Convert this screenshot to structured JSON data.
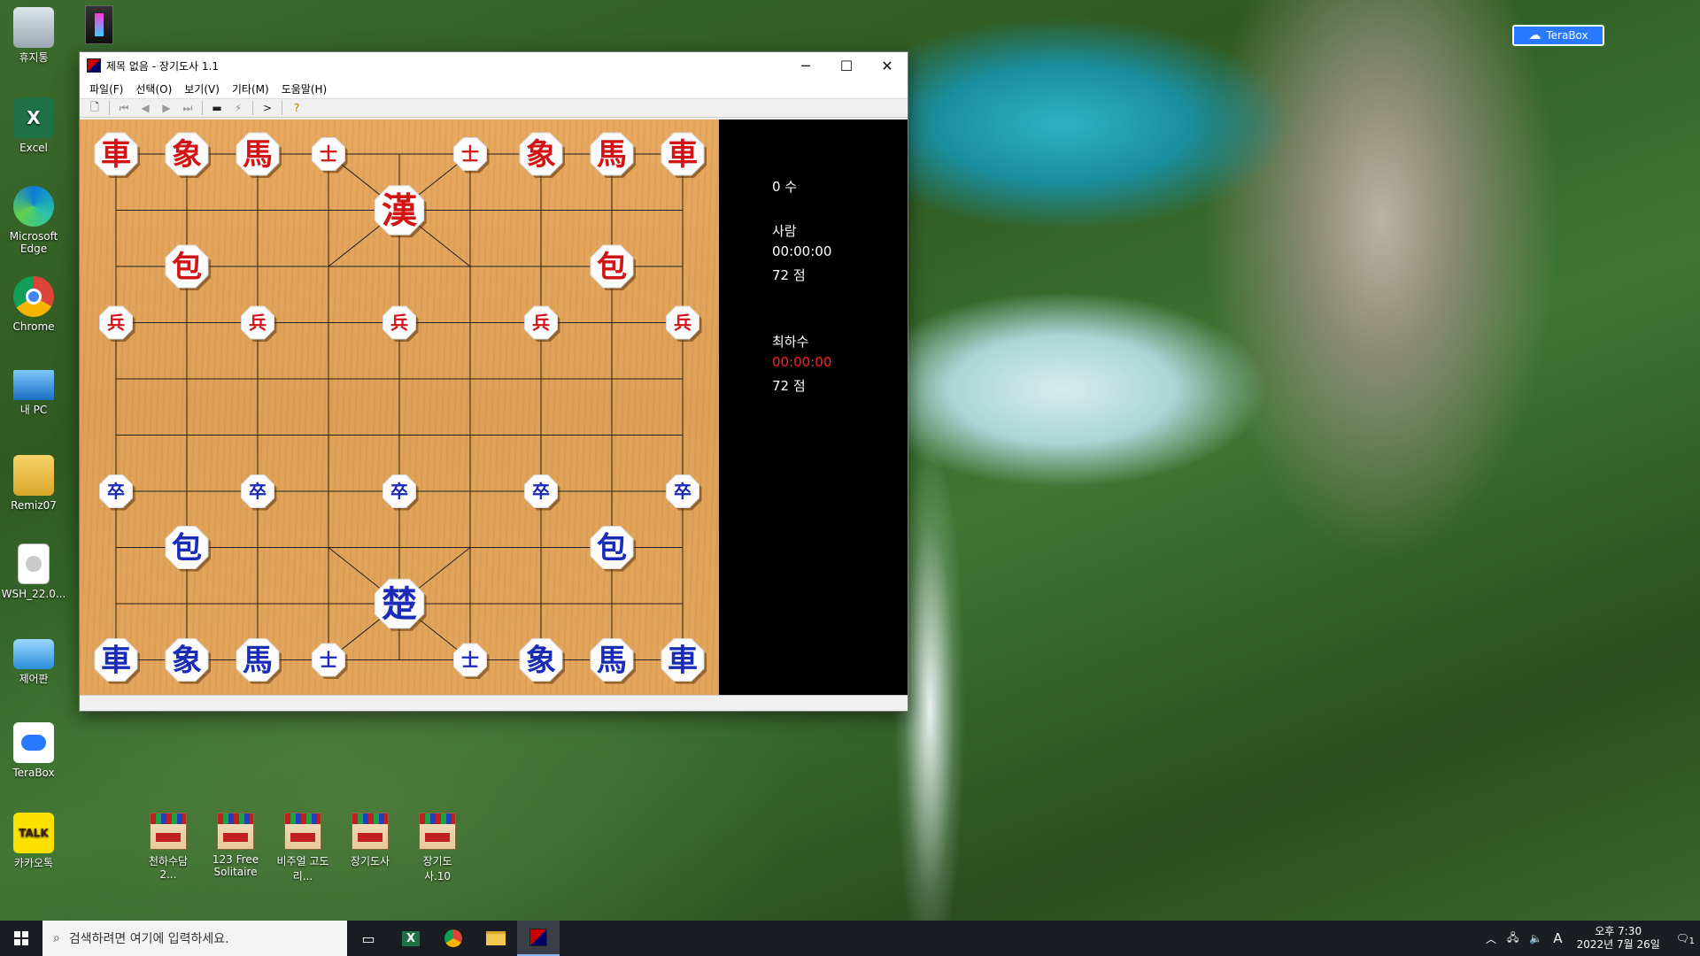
{
  "desktop": {
    "icons": [
      {
        "label": "휴지통"
      },
      {
        "label": "Excel"
      },
      {
        "label": "Microsoft Edge"
      },
      {
        "label": "Chrome"
      },
      {
        "label": "내 PC"
      },
      {
        "label": "Remiz07"
      },
      {
        "label": "WSH_22.0..."
      },
      {
        "label": "제어판"
      },
      {
        "label": "TeraBox"
      },
      {
        "label": "카카오톡"
      }
    ],
    "bottom_icons": [
      {
        "label": "천하수담2..."
      },
      {
        "label": "123 Free Solitaire"
      },
      {
        "label": "비주얼 고도리..."
      },
      {
        "label": "장기도사"
      },
      {
        "label": "장기도사.10"
      }
    ],
    "terabox_badge": "TeraBox"
  },
  "window": {
    "title": "제목 없음 - 장기도사 1.1",
    "menu": [
      "파일(F)",
      "선택(O)",
      "보기(V)",
      "기타(M)",
      "도움말(H)"
    ],
    "controls": {
      "minimize": "─",
      "maximize": "☐",
      "close": "✕"
    }
  },
  "board": {
    "red_pieces": [
      {
        "char": "車",
        "col": 0,
        "row": 0
      },
      {
        "char": "象",
        "col": 1,
        "row": 0
      },
      {
        "char": "馬",
        "col": 2,
        "row": 0
      },
      {
        "char": "士",
        "col": 3,
        "row": 0
      },
      {
        "char": "士",
        "col": 5,
        "row": 0
      },
      {
        "char": "象",
        "col": 6,
        "row": 0
      },
      {
        "char": "馬",
        "col": 7,
        "row": 0
      },
      {
        "char": "車",
        "col": 8,
        "row": 0
      },
      {
        "char": "漢",
        "col": 4,
        "row": 1
      },
      {
        "char": "包",
        "col": 1,
        "row": 2
      },
      {
        "char": "包",
        "col": 7,
        "row": 2
      },
      {
        "char": "兵",
        "col": 0,
        "row": 3
      },
      {
        "char": "兵",
        "col": 2,
        "row": 3
      },
      {
        "char": "兵",
        "col": 4,
        "row": 3
      },
      {
        "char": "兵",
        "col": 6,
        "row": 3
      },
      {
        "char": "兵",
        "col": 8,
        "row": 3
      }
    ],
    "blue_pieces": [
      {
        "char": "卒",
        "col": 0,
        "row": 6
      },
      {
        "char": "卒",
        "col": 2,
        "row": 6
      },
      {
        "char": "卒",
        "col": 4,
        "row": 6
      },
      {
        "char": "卒",
        "col": 6,
        "row": 6
      },
      {
        "char": "卒",
        "col": 8,
        "row": 6
      },
      {
        "char": "包",
        "col": 1,
        "row": 7
      },
      {
        "char": "包",
        "col": 7,
        "row": 7
      },
      {
        "char": "楚",
        "col": 4,
        "row": 8
      },
      {
        "char": "車",
        "col": 0,
        "row": 9
      },
      {
        "char": "象",
        "col": 1,
        "row": 9
      },
      {
        "char": "馬",
        "col": 2,
        "row": 9
      },
      {
        "char": "士",
        "col": 3,
        "row": 9
      },
      {
        "char": "士",
        "col": 5,
        "row": 9
      },
      {
        "char": "象",
        "col": 6,
        "row": 9
      },
      {
        "char": "馬",
        "col": 7,
        "row": 9
      },
      {
        "char": "車",
        "col": 8,
        "row": 9
      }
    ],
    "colors": {
      "red": "#d21414",
      "blue": "#1a2bb8"
    }
  },
  "panel": {
    "move_count": "0 수",
    "player1_name": "사람",
    "player1_time": "00:00:00",
    "player1_score": "72 점",
    "player2_name": "최하수",
    "player2_time": "00:00:00",
    "player2_score": "72 점",
    "player2_time_color": "#ff2020"
  },
  "taskbar": {
    "search_placeholder": "검색하려면 여기에 입력하세요.",
    "time": "오후 7:30",
    "date": "2022년 7월 26일",
    "ime": "A",
    "notification_count": "1"
  }
}
